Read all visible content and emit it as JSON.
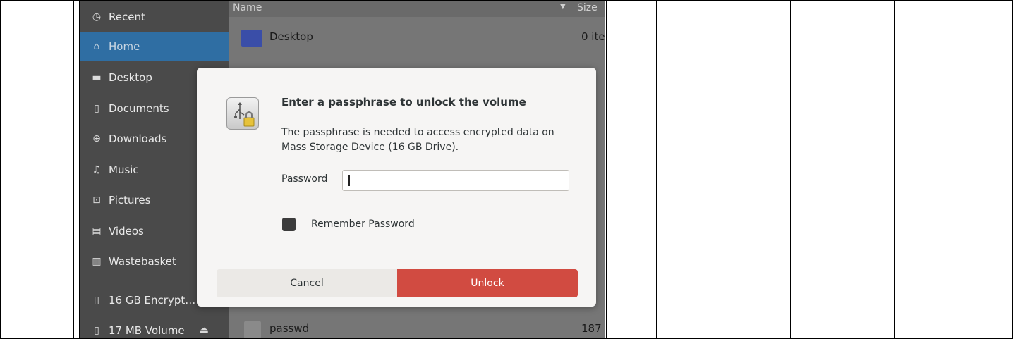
{
  "sidebar": {
    "items": [
      {
        "label": "Recent",
        "icon": "clock-icon",
        "glyph": "◷"
      },
      {
        "label": "Home",
        "icon": "home-icon",
        "glyph": "⌂"
      },
      {
        "label": "Desktop",
        "icon": "folder-icon",
        "glyph": "▬"
      },
      {
        "label": "Documents",
        "icon": "document-icon",
        "glyph": "▯"
      },
      {
        "label": "Downloads",
        "icon": "download-icon",
        "glyph": "⊕"
      },
      {
        "label": "Music",
        "icon": "music-icon",
        "glyph": "♫"
      },
      {
        "label": "Pictures",
        "icon": "picture-icon",
        "glyph": "⊡"
      },
      {
        "label": "Videos",
        "icon": "video-icon",
        "glyph": "▤"
      },
      {
        "label": "Wastebasket",
        "icon": "trash-icon",
        "glyph": "▥"
      },
      {
        "label": "16 GB Encrypt…",
        "icon": "drive-icon",
        "glyph": "▯"
      },
      {
        "label": "17 MB Volume",
        "icon": "drive-icon",
        "glyph": "▯"
      }
    ],
    "active_index": 1,
    "eject_glyph": "⏏"
  },
  "filelist": {
    "header": {
      "name": "Name",
      "size": "Size"
    },
    "rows": [
      {
        "name": "Desktop",
        "size": "0 ite"
      },
      {
        "name": "passwd",
        "size": "187"
      }
    ]
  },
  "dialog": {
    "title": "Enter a passphrase to unlock the volume",
    "description_line1": "The passphrase is needed to access encrypted data on",
    "description_line2": "Mass Storage Device (16 GB Drive).",
    "password_label": "Password",
    "password_value": "",
    "remember_label": "Remember Password",
    "remember_checked": false,
    "cancel_label": "Cancel",
    "unlock_label": "Unlock",
    "unlock_color": "#d14b41"
  }
}
